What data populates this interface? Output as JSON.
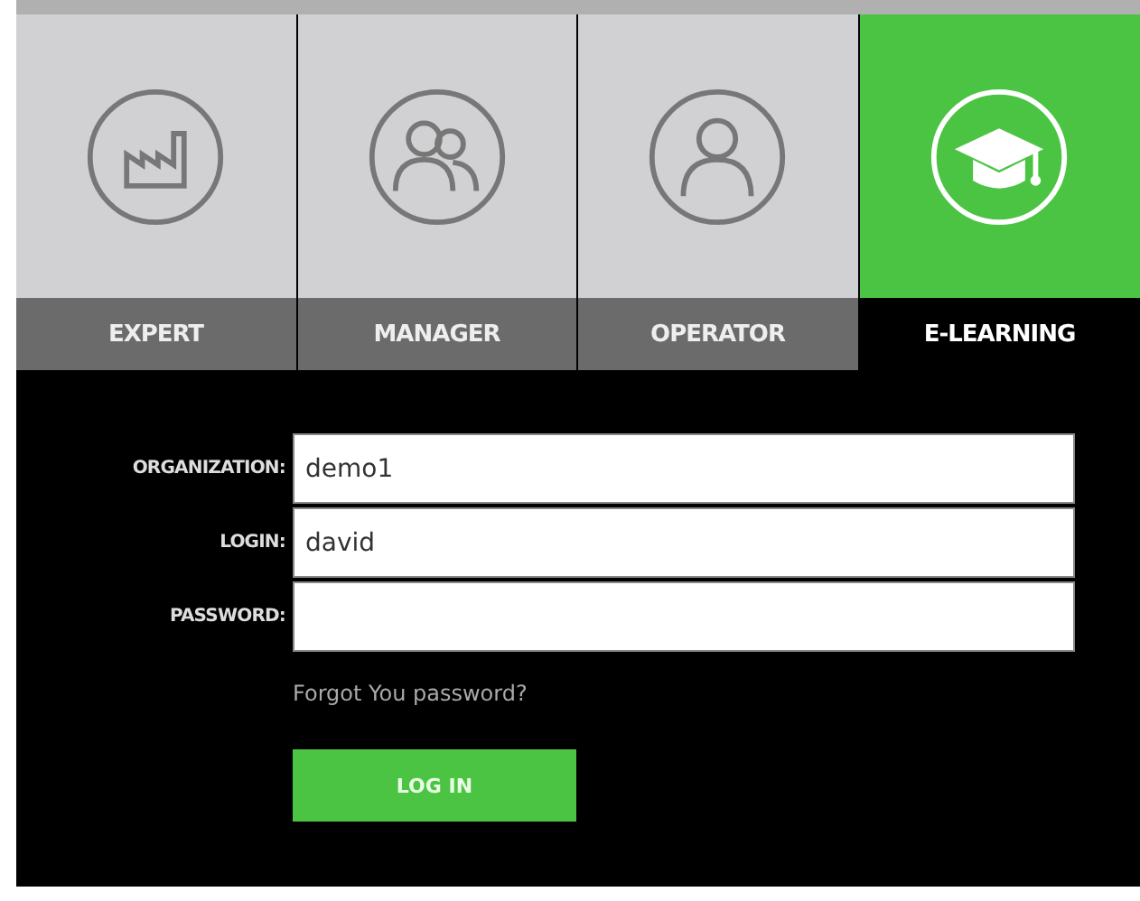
{
  "roles": [
    {
      "label": "EXPERT",
      "kind": "factory",
      "selected": false
    },
    {
      "label": "MANAGER",
      "kind": "group",
      "selected": false
    },
    {
      "label": "OPERATOR",
      "kind": "person",
      "selected": false
    },
    {
      "label": "E-LEARNING",
      "kind": "cap",
      "selected": true
    }
  ],
  "form": {
    "fields": [
      {
        "label": "ORGANIZATION:",
        "value": "demo1",
        "kind": "text"
      },
      {
        "label": "LOGIN:",
        "value": "david",
        "kind": "text"
      },
      {
        "label": "PASSWORD:",
        "kind": "password"
      }
    ],
    "forgot_link": "Forgot You password?",
    "submit": "LOG IN"
  }
}
